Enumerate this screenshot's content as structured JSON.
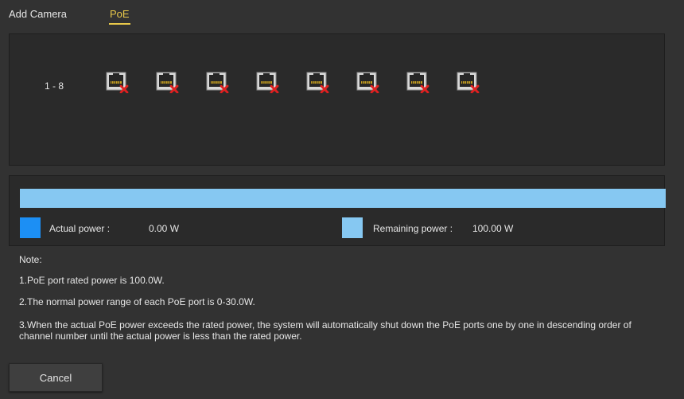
{
  "tabs": [
    {
      "label": "Add Camera",
      "active": false
    },
    {
      "label": "PoE",
      "active": true
    }
  ],
  "ports": {
    "range_label": "1 - 8",
    "items": [
      {
        "icon": "ethernet-port-disconnected-icon"
      },
      {
        "icon": "ethernet-port-disconnected-icon"
      },
      {
        "icon": "ethernet-port-disconnected-icon"
      },
      {
        "icon": "ethernet-port-disconnected-icon"
      },
      {
        "icon": "ethernet-port-disconnected-icon"
      },
      {
        "icon": "ethernet-port-disconnected-icon"
      },
      {
        "icon": "ethernet-port-disconnected-icon"
      },
      {
        "icon": "ethernet-port-disconnected-icon"
      }
    ]
  },
  "power": {
    "used_fraction": 0.0,
    "actual_label": "Actual power :",
    "actual_value": "0.00 W",
    "remaining_label": "Remaining power :",
    "remaining_value": "100.00 W",
    "colors": {
      "actual": "#1c8ff4",
      "remaining": "#86c8f2"
    }
  },
  "notes": {
    "title": "Note:",
    "line1": "1.PoE port rated power is 100.0W.",
    "line2": "2.The normal power range of each PoE port is 0-30.0W.",
    "line3": "3.When the actual PoE power exceeds the rated power, the system will automatically shut down the PoE ports one by one in descending order of channel number until the actual power is less than the rated power."
  },
  "buttons": {
    "cancel": "Cancel"
  },
  "colors": {
    "accent": "#e8c84a",
    "background": "#323232",
    "panel": "#2a2a2a"
  }
}
